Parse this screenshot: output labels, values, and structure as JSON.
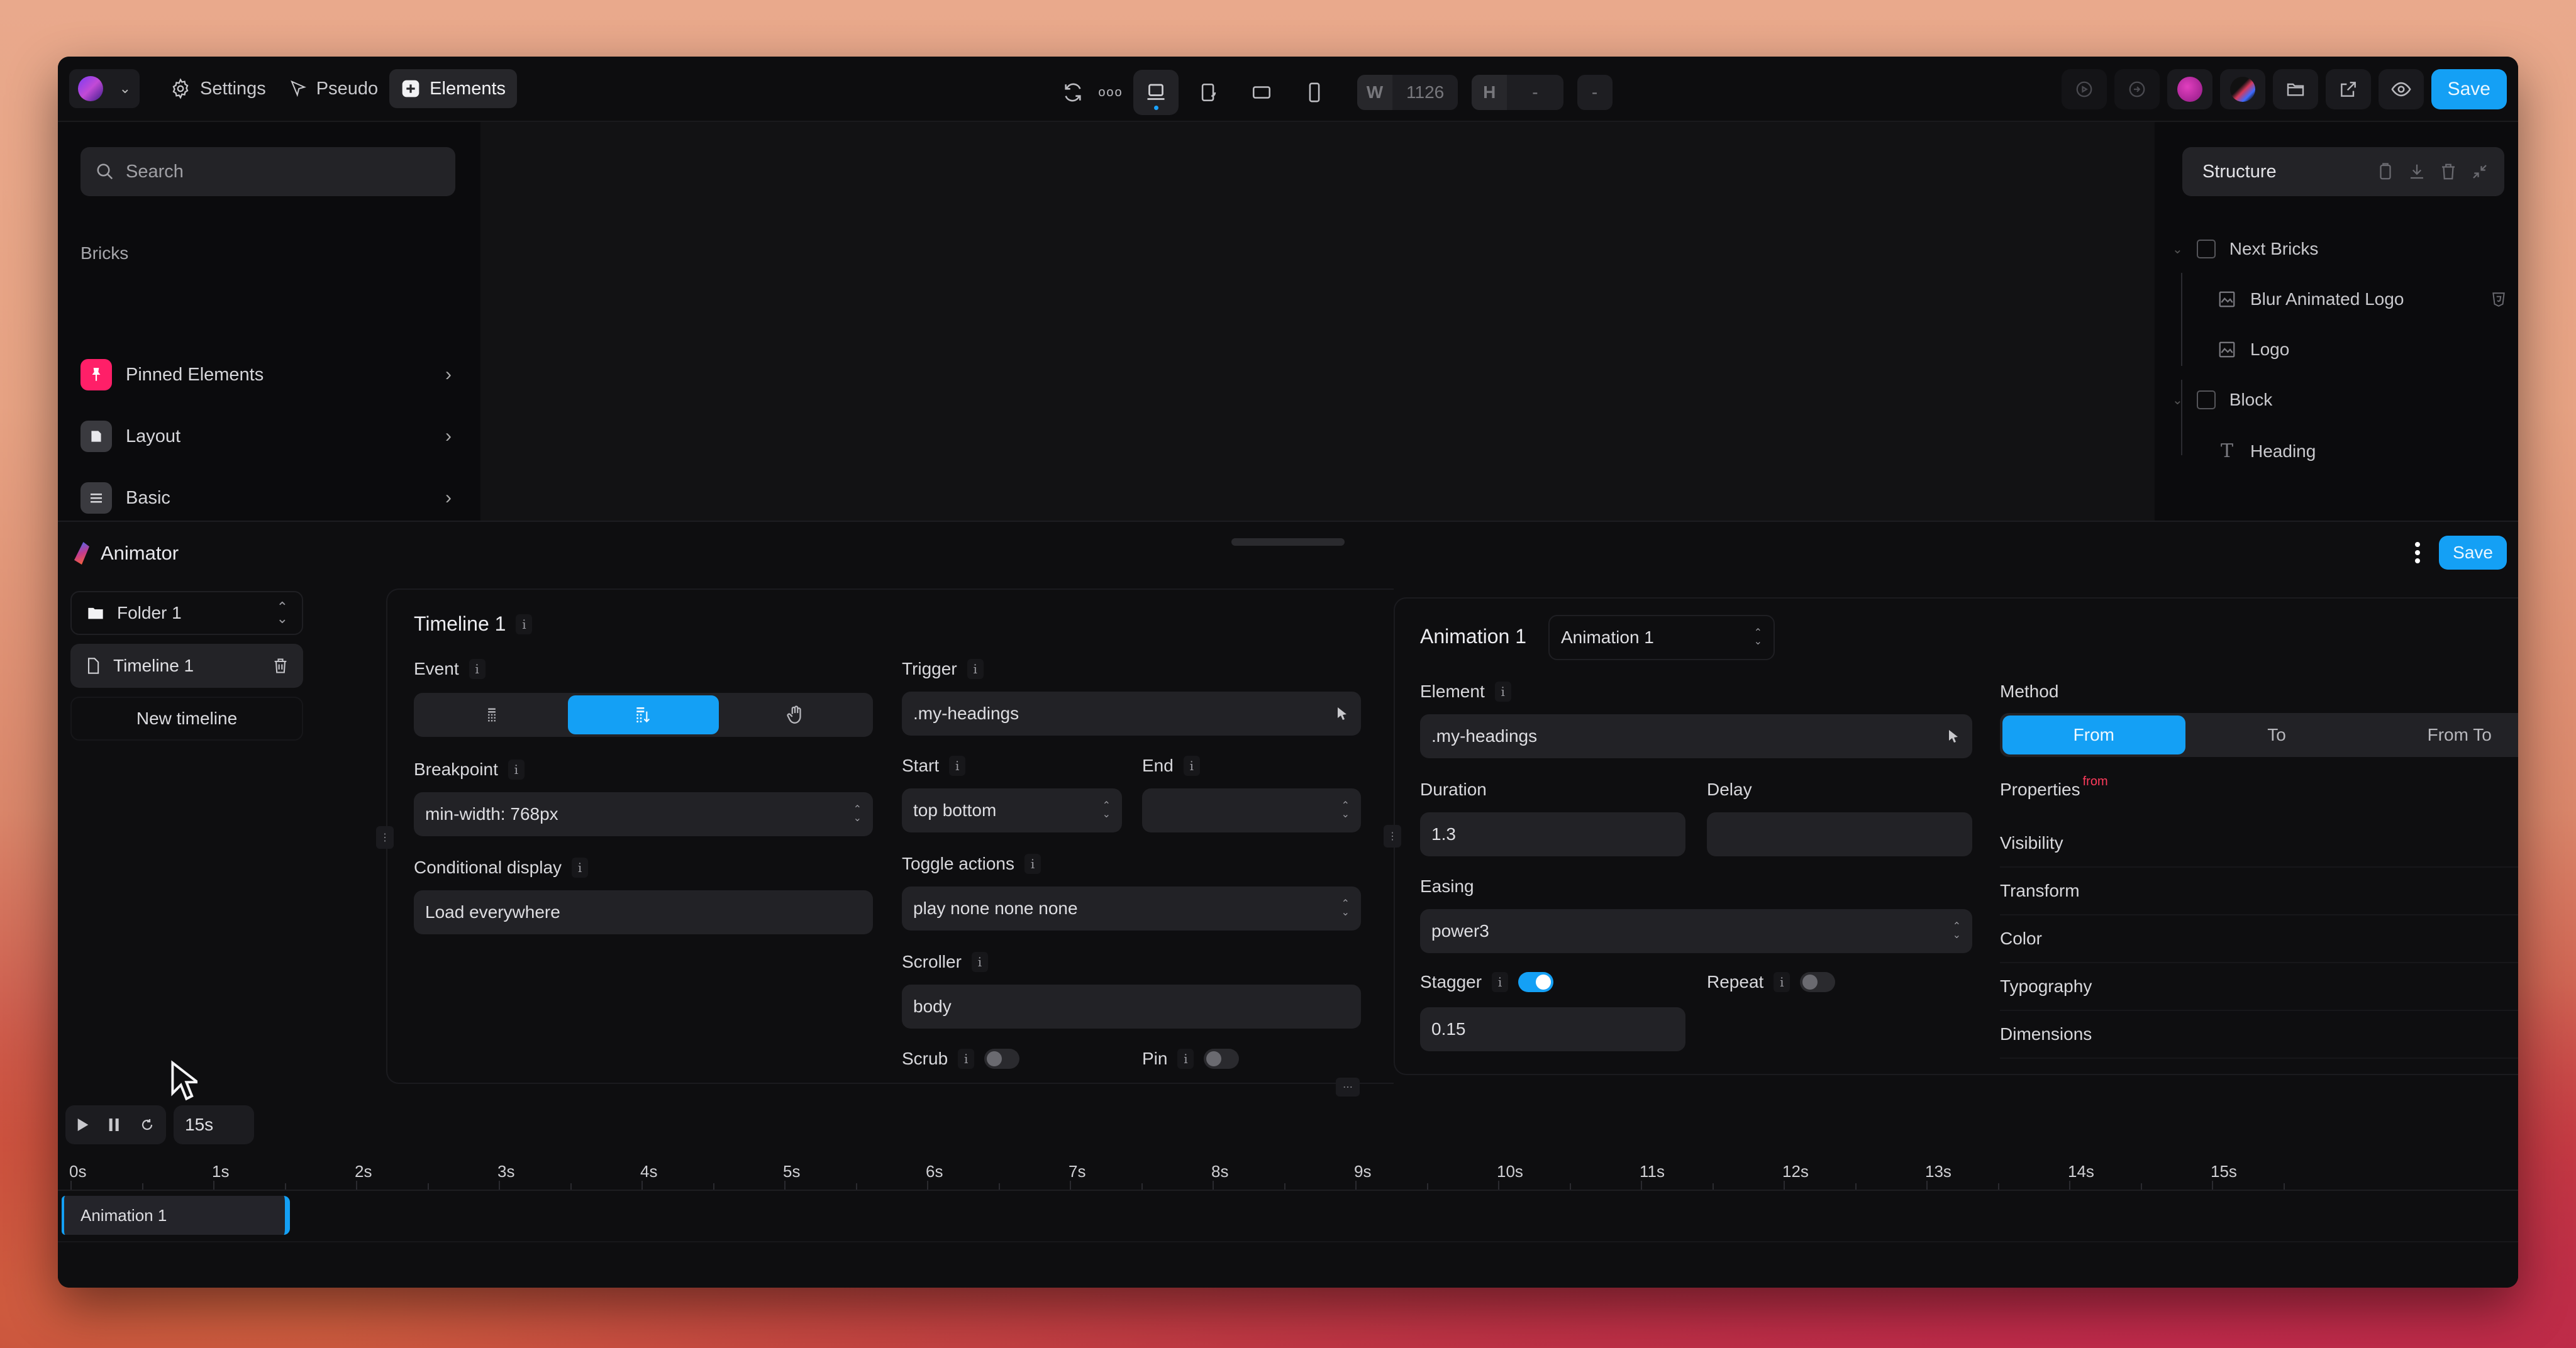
{
  "topbar": {
    "logo_alt": "Bricks builder menu",
    "settings_label": "Settings",
    "pseudo_label": "Pseudo",
    "elements_label": "Elements",
    "width_label": "W",
    "width_value": "1126",
    "height_label": "H",
    "height_value": "-",
    "extra_value": "-",
    "save_label": "Save"
  },
  "left_panel": {
    "search_placeholder": "Search",
    "section_label": "Bricks",
    "categories": [
      {
        "label": "Pinned Elements",
        "icon": "pin-icon",
        "color": "#ff1f68"
      },
      {
        "label": "Layout",
        "icon": "layout-icon",
        "color": "#3a3a3f"
      },
      {
        "label": "Basic",
        "icon": "basic-icon",
        "color": "#3a3a3f"
      }
    ]
  },
  "structure": {
    "title": "Structure",
    "tree": [
      {
        "label": "Next Bricks",
        "type": "container",
        "level": 0
      },
      {
        "label": "Blur Animated Logo",
        "type": "image",
        "level": 1
      },
      {
        "label": "Logo",
        "type": "image",
        "level": 1
      },
      {
        "label": "Block",
        "type": "container",
        "level": 0
      },
      {
        "label": "Heading",
        "type": "text",
        "level": 1
      }
    ]
  },
  "animator": {
    "title": "Animator",
    "save_label": "Save",
    "folder": "Folder 1",
    "timelines": [
      "Timeline 1"
    ],
    "new_timeline_label": "New timeline",
    "timeline_panel": {
      "title": "Timeline 1",
      "event_label": "Event",
      "event_options": [
        "page-load",
        "scroll",
        "click"
      ],
      "event_selected": "scroll",
      "breakpoint_label": "Breakpoint",
      "breakpoint_value": "min-width: 768px",
      "conditional_label": "Conditional display",
      "conditional_value": "Load everywhere",
      "trigger_label": "Trigger",
      "trigger_value": ".my-headings",
      "start_label": "Start",
      "start_value": "top bottom",
      "end_label": "End",
      "end_value": "",
      "toggle_actions_label": "Toggle actions",
      "toggle_actions_value": "play none none none",
      "scroller_label": "Scroller",
      "scroller_value": "body",
      "scrub_label": "Scrub",
      "scrub_on": false,
      "pin_label": "Pin",
      "pin_on": false
    },
    "animation_panel": {
      "title": "Animation 1",
      "select_value": "Animation 1",
      "element_label": "Element",
      "element_value": ".my-headings",
      "duration_label": "Duration",
      "duration_value": "1.3",
      "delay_label": "Delay",
      "delay_value": "",
      "easing_label": "Easing",
      "easing_value": "power3",
      "stagger_label": "Stagger",
      "stagger_on": true,
      "stagger_value": "0.15",
      "repeat_label": "Repeat",
      "repeat_on": false,
      "method_label": "Method",
      "methods": [
        "From",
        "To",
        "From To"
      ],
      "method_selected": "From",
      "properties_label": "Properties",
      "properties_badge": "from",
      "properties": [
        "Visibility",
        "Transform",
        "Color",
        "Typography",
        "Dimensions"
      ]
    },
    "playback": {
      "duration": "15s"
    },
    "ruler": [
      "0s",
      "1s",
      "2s",
      "3s",
      "4s",
      "5s",
      "6s",
      "7s",
      "8s",
      "9s",
      "10s",
      "11s",
      "12s",
      "13s",
      "14s",
      "15s"
    ],
    "tracks": [
      {
        "label": "Animation 1",
        "start_s": 0,
        "end_s": 1.6
      }
    ]
  },
  "colors": {
    "accent": "#14a0f5",
    "pinned": "#ff1f68",
    "badge": "#ff3b5c"
  }
}
